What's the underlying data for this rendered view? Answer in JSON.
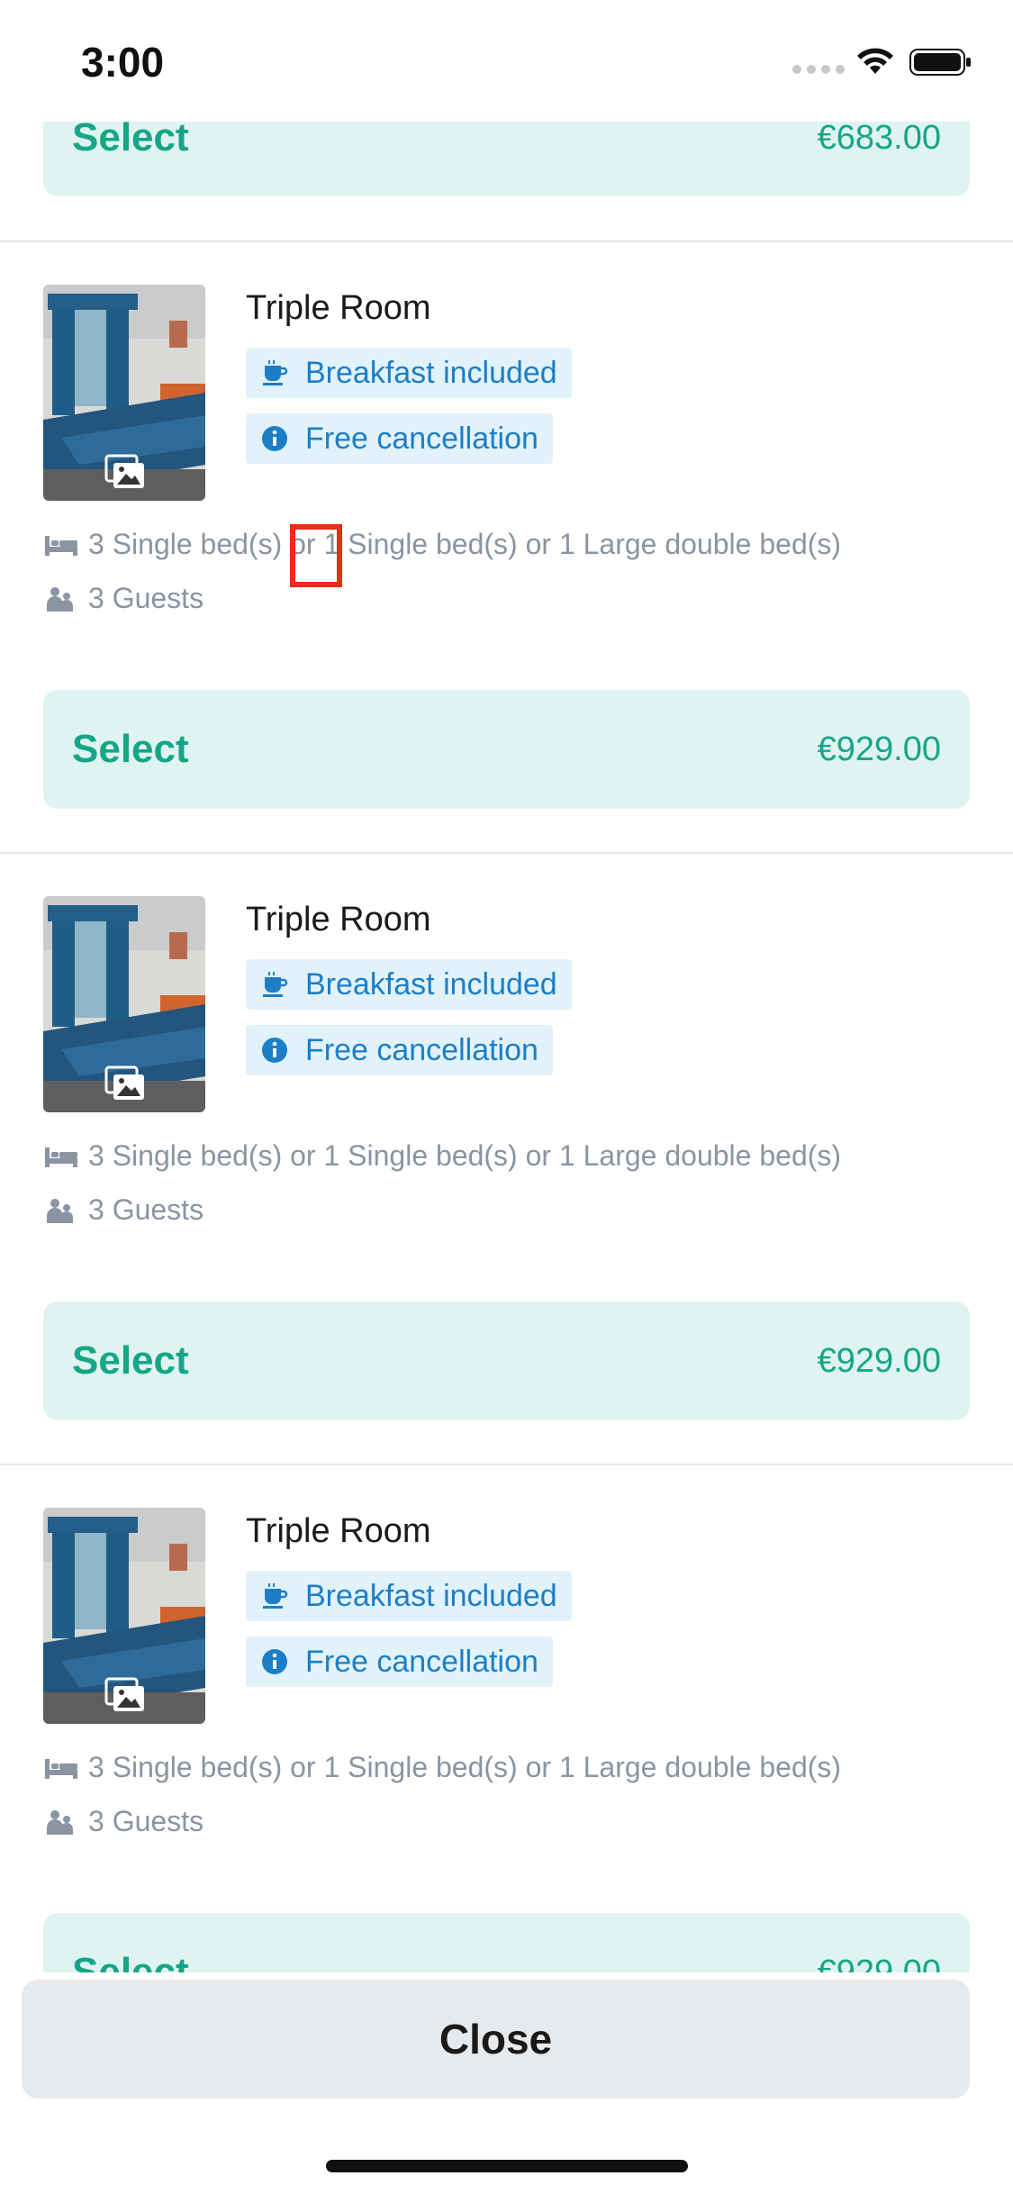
{
  "status_bar": {
    "time": "3:00"
  },
  "top_partial": {
    "select_label": "Select",
    "price": "€683.00"
  },
  "rooms": [
    {
      "title": "Triple Room",
      "tags": [
        "Breakfast included",
        "Free cancellation"
      ],
      "beds": [
        "3 Single bed(s)",
        "or",
        "1 Single bed(s) or 1 Large double bed(s)"
      ],
      "guests": "3 Guests",
      "select_label": "Select",
      "price": "€929.00"
    },
    {
      "title": "Triple Room",
      "tags": [
        "Breakfast included",
        "Free cancellation"
      ],
      "beds": [
        "3 Single bed(s)",
        "or",
        "1 Single bed(s) or 1 Large double bed(s)"
      ],
      "guests": "3 Guests",
      "select_label": "Select",
      "price": "€929.00"
    },
    {
      "title": "Triple Room",
      "tags": [
        "Breakfast included",
        "Free cancellation"
      ],
      "beds": [
        "3 Single bed(s)",
        "or",
        "1 Single bed(s) or 1 Large double bed(s)"
      ],
      "guests": "3 Guests",
      "select_label": "Select",
      "price": "€929.00"
    }
  ],
  "footer": {
    "close_label": "Close"
  },
  "colors": {
    "accent": "#16a589",
    "tag_text": "#1c7ec6",
    "tag_bg": "#e1f2fb",
    "select_bg": "#dff4f0",
    "highlight": "#ee2a1a"
  }
}
